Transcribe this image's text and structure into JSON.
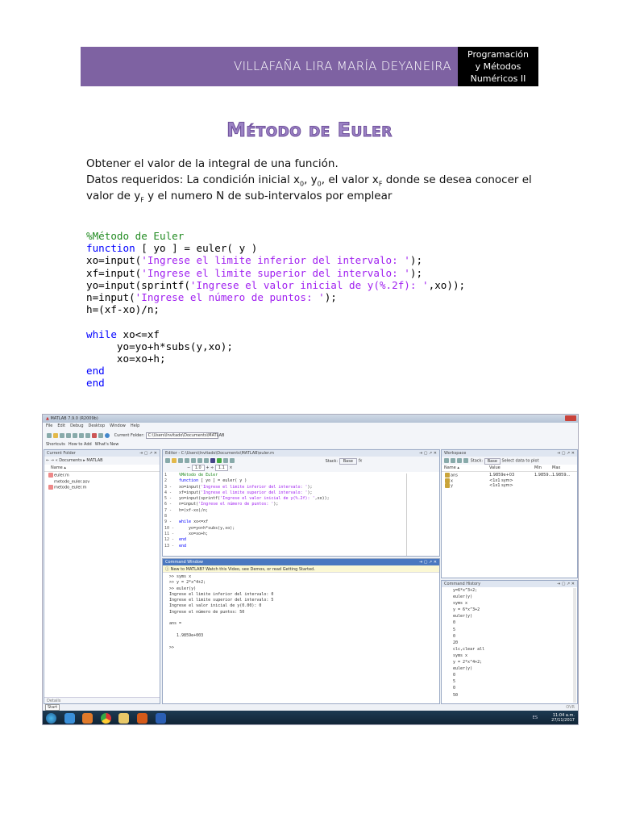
{
  "header": {
    "author": "VILLAFAÑA LIRA MARÍA DEYANEIRA",
    "course_lines": [
      "Programación",
      "y Métodos",
      "Numéricos II"
    ]
  },
  "title": "Método de Euler",
  "intro": {
    "line1": "Obtener el valor de la integral de una función.",
    "line2_a": "Datos requeridos: La condición inicial x",
    "line2_b": "0",
    "line2_c": ", y",
    "line2_d": "0",
    "line2_e": ", el valor x",
    "line2_f": "F",
    "line2_g": " donde se desea conocer el",
    "line3_a": "valor de y",
    "line3_b": "F",
    "line3_c": " y el numero N de sub-intervalos por emplear"
  },
  "code": {
    "comment": "%Método de Euler",
    "l2_kw": "function",
    "l2_rest": " [ yo ] = euler( y )",
    "l3a": "xo=input(",
    "l3s": "'Ingrese el limite inferior del intervalo: '",
    "l3b": ");",
    "l4a": "xf=input(",
    "l4s": "'Ingrese el limite superior del intervalo: '",
    "l4b": ");",
    "l5a": "yo=input(sprintf(",
    "l5s": "'Ingrese el valor inicial de y(%.2f): '",
    "l5b": ",xo));",
    "l6a": "n=input(",
    "l6s": "'Ingrese el número de puntos: '",
    "l6b": ");",
    "l7": "h=(xf-xo)/n;",
    "l9_kw": "while",
    "l9_rest": " xo<=xf",
    "l10": "     yo=yo+h*subs(y,xo);",
    "l11": "     xo=xo+h;",
    "end1": "end",
    "end2": "end"
  },
  "matlab": {
    "window_title": "MATLAB 7.9.0 (R2009b)",
    "menu": [
      "File",
      "Edit",
      "Debug",
      "Desktop",
      "Window",
      "Help"
    ],
    "current_folder_label": "Current Folder:",
    "current_folder_path": "C:\\Users\\Invitado\\Documents\\MATLAB",
    "shortcuts": [
      "Shortcuts",
      "How to Add",
      "What's New"
    ],
    "folder_panel": {
      "title": "Current Folder",
      "path": "« Documents ▸ MATLAB",
      "col": "Name ▴",
      "files": [
        "euler.m",
        "metodo_euler.asv",
        "metodo_euler.m"
      ],
      "details": "Details"
    },
    "editor": {
      "title": "Editor - C:\\Users\\Invitado\\Documents\\MATLAB\\euler.m",
      "stack": "Stack:",
      "stack_val": "Base",
      "zoom1": "1.0",
      "zoom2": "1.1",
      "lines": [
        {
          "n": "1",
          "t": "%Método de Euler"
        },
        {
          "n": "2",
          "t": "function [ yo ] = euler( y )"
        },
        {
          "n": "3 -",
          "t": "xo=input('Ingrese el limite inferior del intervalo: ');"
        },
        {
          "n": "4 -",
          "t": "xf=input('Ingrese el limite superior del intervalo: ');"
        },
        {
          "n": "5 -",
          "t": "yo=input(sprintf('Ingrese el valor inicial de y(%.2f): ',xo));"
        },
        {
          "n": "6 -",
          "t": "n=input('Ingrese el número de puntos: ');"
        },
        {
          "n": "7 -",
          "t": "h=(xf-xo)/n;"
        },
        {
          "n": "8",
          "t": ""
        },
        {
          "n": "9 -",
          "t": "while xo<=xf"
        },
        {
          "n": "10 -",
          "t": "    yo=yo+h*subs(y,xo);"
        },
        {
          "n": "11 -",
          "t": "    xo=xo+h;"
        },
        {
          "n": "12 -",
          "t": "end"
        },
        {
          "n": "13 -",
          "t": "end"
        }
      ]
    },
    "command_window": {
      "title": "Command Window",
      "notice": "New to MATLAB? Watch this Video, see Demos, or read Getting Started.",
      "lines": [
        ">> syms x",
        ">> y = 2*x^4+2;",
        ">> euler(y)",
        "Ingrese el limite inferior del intervalo: 0",
        "Ingrese el limite superior del intervalo: 5",
        "Ingrese el valor inicial de y(0.00): 0",
        "Ingrese el número de puntos: 50",
        "",
        "ans =",
        "",
        "   1.9859e+003",
        "",
        ">>"
      ]
    },
    "workspace": {
      "title": "Workspace",
      "stack": "Stack:",
      "stack_val": "Base",
      "plot": "Select data to plot",
      "cols": [
        "Name ▴",
        "Value",
        "Min",
        "Max"
      ],
      "rows": [
        {
          "name": "ans",
          "value": "1.9859e+03",
          "min": "1.9859...",
          "max": "1.9859..."
        },
        {
          "name": "x",
          "value": "<1x1 sym>",
          "min": "",
          "max": ""
        },
        {
          "name": "y",
          "value": "<1x1 sym>",
          "min": "",
          "max": ""
        }
      ]
    },
    "history": {
      "title": "Command History",
      "lines": [
        "y=6*x^3+2;",
        "euler(y)",
        "syms x",
        "y = 6*x^3+2",
        "euler(y)",
        "0",
        "5",
        "0",
        "20",
        "clc,clear all",
        "syms x",
        "y = 2*x^4+2;",
        "euler(y)",
        "0",
        "5",
        "0",
        "50"
      ]
    },
    "start": "Start",
    "ovr": "OVR",
    "clock_time": "11:04 a.m.",
    "clock_date": "27/11/2017",
    "lang": "ES"
  }
}
